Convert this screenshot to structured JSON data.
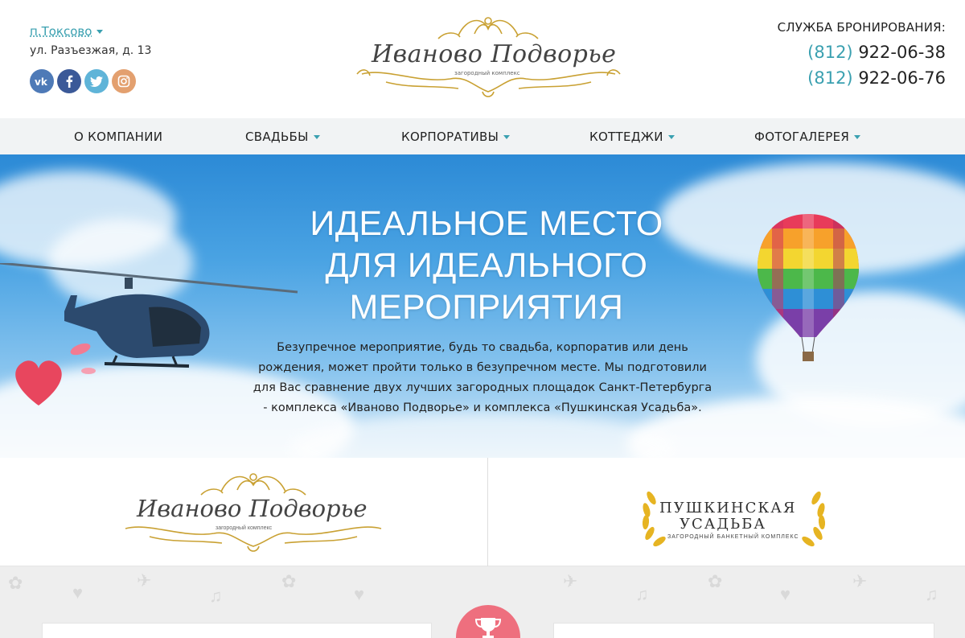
{
  "header": {
    "city": "п.Токсово",
    "address": "ул. Разъезжая, д. 13",
    "socials": [
      "vk",
      "f",
      "t",
      "ig"
    ],
    "logo_title": "Иваново Подворье",
    "logo_subtitle": "загородный комплекс",
    "booking_title": "СЛУЖБА БРОНИРОВАНИЯ:",
    "phones": [
      {
        "code": "(812)",
        "number": "922-06-38"
      },
      {
        "code": "(812)",
        "number": "922-06-76"
      }
    ]
  },
  "nav": {
    "items": [
      {
        "label": "О КОМПАНИИ"
      },
      {
        "label": "СВАДЬБЫ"
      },
      {
        "label": "КОРПОРАТИВЫ"
      },
      {
        "label": "КОТТЕДЖИ"
      },
      {
        "label": "ФОТОГАЛЕРЕЯ"
      }
    ]
  },
  "hero": {
    "title_line1": "ИДЕАЛЬНОЕ МЕСТО",
    "title_line2": "ДЛЯ ИДЕАЛЬНОГО",
    "title_line3": "МЕРОПРИЯТИЯ",
    "text": "Безупречное мероприятие, будь то свадьба, корпоратив или день рождения, может пройти только в безупречном месте. Мы подготовили для Вас сравнение двух лучших загородных площадок Санкт-Петербурга - комплекса «Иваново Подворье» и комплекса «Пушкинская Усадьба»."
  },
  "venues": {
    "left_title": "Иваново Подворье",
    "left_subtitle": "загородный комплекс",
    "right_line1": "ПУШКИНСКАЯ",
    "right_line2": "УСАДЬБА",
    "right_subtitle": "ЗАГОРОДНЫЙ БАНКЕТНЫЙ КОМПЛЕКС"
  },
  "colors": {
    "accent": "#3aa0b0",
    "gold": "#c9a133",
    "trophy_bg": "#ee6f7e"
  }
}
